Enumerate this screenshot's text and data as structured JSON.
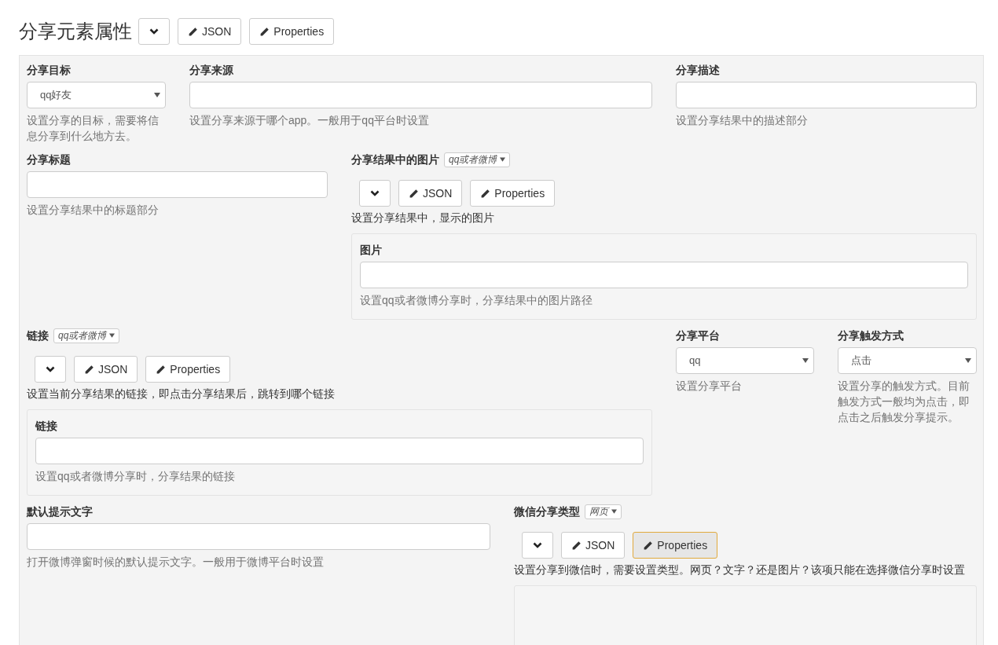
{
  "header": {
    "title": "分享元素属性",
    "toolbar": [
      {
        "kind": "collapse",
        "selected": false
      },
      {
        "kind": "edit",
        "label": "JSON",
        "selected": false
      },
      {
        "kind": "edit",
        "label": "Properties",
        "selected": false
      }
    ]
  },
  "rows": [
    [
      {
        "kind": "select",
        "label": "分享目标",
        "value": "qq好友",
        "help": "设置分享的目标，需要将信息分享到什么地方去。"
      },
      {
        "kind": "input",
        "label": "分享来源",
        "help": "设置分享来源于哪个app。一般用于qq平台时设置"
      },
      {
        "kind": "input",
        "label": "分享描述",
        "help": "设置分享结果中的描述部分"
      }
    ],
    [
      {
        "kind": "input",
        "label": "分享标题",
        "help": "设置分享结果中的标题部分"
      },
      {
        "kind": "object",
        "label": "分享结果中的图片",
        "type": "qq或者微博",
        "toolbar": [
          {
            "kind": "collapse",
            "selected": false
          },
          {
            "kind": "edit",
            "label": "JSON",
            "selected": false
          },
          {
            "kind": "edit",
            "label": "Properties",
            "selected": false
          }
        ],
        "help": "设置分享结果中，显示的图片",
        "fields": [
          {
            "kind": "input",
            "label": "图片",
            "help": "设置qq或者微博分享时，分享结果中的图片路径"
          }
        ]
      }
    ],
    [
      {
        "kind": "object",
        "label": "链接",
        "type": "qq或者微博",
        "toolbar": [
          {
            "kind": "collapse",
            "selected": false
          },
          {
            "kind": "edit",
            "label": "JSON",
            "selected": false
          },
          {
            "kind": "edit",
            "label": "Properties",
            "selected": false
          }
        ],
        "help": "设置当前分享结果的链接，即点击分享结果后，跳转到哪个链接",
        "fields": [
          {
            "kind": "input",
            "label": "链接",
            "help": "设置qq或者微博分享时，分享结果的链接"
          }
        ]
      },
      {
        "kind": "select",
        "label": "分享平台",
        "value": "qq",
        "help": "设置分享平台"
      },
      {
        "kind": "select",
        "label": "分享触发方式",
        "value": "点击",
        "help": "设置分享的触发方式。目前触发方式一般均为点击，即点击之后触发分享提示。"
      }
    ],
    [
      {
        "kind": "input",
        "label": "默认提示文字",
        "help": "打开微博弹窗时候的默认提示文字。一般用于微博平台时设置"
      },
      {
        "kind": "object",
        "label": "微信分享类型",
        "type": "网页",
        "toolbar": [
          {
            "kind": "collapse",
            "selected": false
          },
          {
            "kind": "edit",
            "label": "JSON",
            "selected": false
          },
          {
            "kind": "edit",
            "label": "Properties",
            "selected": true
          }
        ],
        "help": "设置分享到微信时，需要设置类型。网页？文字？还是图片？该项只能在选择微信分享时设置"
      }
    ]
  ]
}
